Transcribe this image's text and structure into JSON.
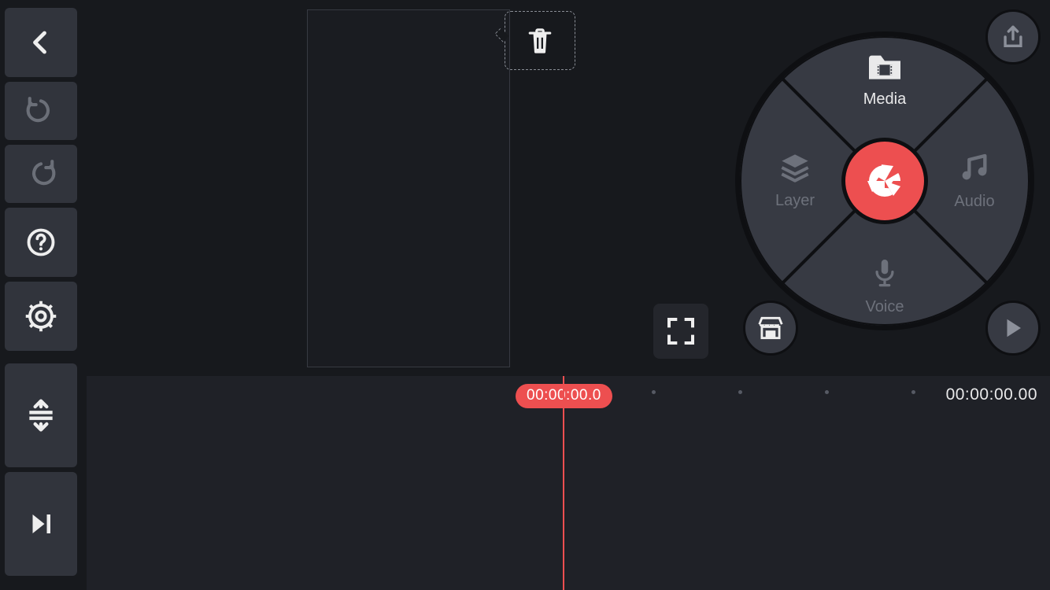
{
  "wheel": {
    "media": "Media",
    "layer": "Layer",
    "audio": "Audio",
    "voice": "Voice"
  },
  "timeline": {
    "playhead": "00:00:00.0",
    "total": "00:00:00.00"
  },
  "colors": {
    "accent": "#ed4f50"
  },
  "icons": {
    "back": "chevron-left",
    "undo": "undo",
    "redo": "redo",
    "help": "help-circle",
    "settings": "gear",
    "expand_tracks": "expand-vertical",
    "step_forward": "skip-forward",
    "trash": "trash",
    "fullscreen": "fullscreen",
    "store": "store",
    "export": "share",
    "play": "play",
    "camera": "aperture",
    "media_folder": "film-folder",
    "layers": "layers",
    "audio_note": "music-note",
    "mic": "microphone"
  }
}
